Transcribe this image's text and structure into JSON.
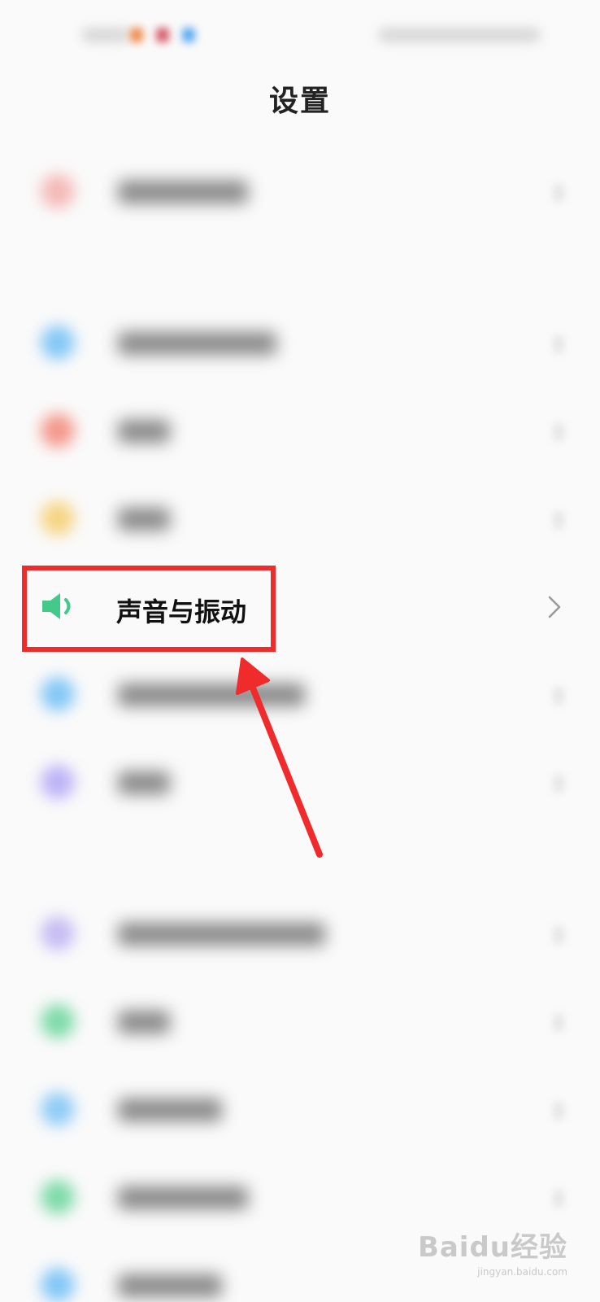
{
  "header": {
    "title": "设置"
  },
  "focused_item": {
    "label": "声音与振动",
    "icon": "speaker-icon",
    "icon_color": "#43c98a"
  },
  "annotation": {
    "box_color": "#ef2b2b",
    "arrow_color": "#ef2b2b"
  },
  "watermark": {
    "brand": "Baidu经验",
    "url": "jingyan.baidu.com"
  },
  "blurred_rows": [
    {
      "icon_color": "#f2a3a0"
    },
    {
      "icon_color": "#5bb6f5"
    },
    {
      "icon_color": "#f27766"
    },
    {
      "icon_color": "#f5c85a"
    },
    {
      "icon_color": "#5bb6f5"
    },
    {
      "icon_color": "#a89bf5"
    },
    {
      "icon_color": "#b5a8f0"
    },
    {
      "icon_color": "#55d08f"
    },
    {
      "icon_color": "#6cbcf5"
    },
    {
      "icon_color": "#55d08f"
    },
    {
      "icon_color": "#5bb6f5"
    }
  ]
}
